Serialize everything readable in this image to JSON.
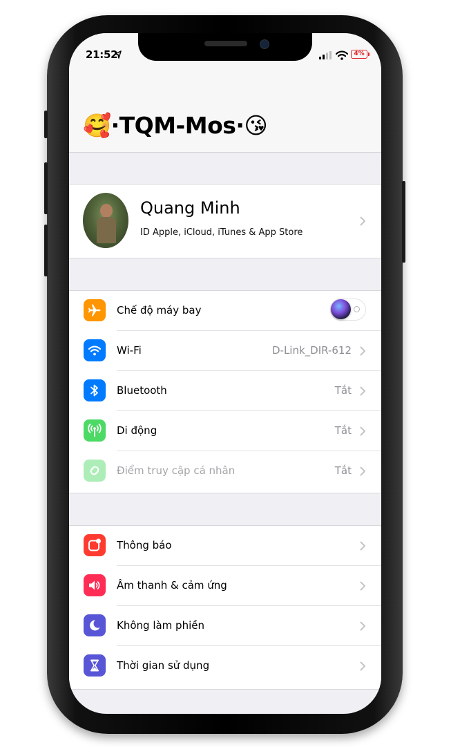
{
  "status": {
    "time": "21:52",
    "battery": "4%",
    "colors": {
      "battery": "#e0242a"
    }
  },
  "header": {
    "title": "🥰·TQM-Mos·😘"
  },
  "profile": {
    "name": "Quang Minh",
    "subtitle": "ID Apple, iCloud, iTunes & App Store"
  },
  "connectivity": [
    {
      "label": "Chế độ máy bay",
      "icon": "airplane-icon",
      "color": "#ff9500",
      "toggle": false
    },
    {
      "label": "Wi-Fi",
      "value": "D-Link_DIR-612",
      "icon": "wifi-icon",
      "color": "#007aff"
    },
    {
      "label": "Bluetooth",
      "value": "Tắt",
      "icon": "bluetooth-icon",
      "color": "#007aff"
    },
    {
      "label": "Di động",
      "value": "Tắt",
      "icon": "cellular-icon",
      "color": "#4cd964"
    },
    {
      "label": "Điểm truy cập cá nhân",
      "value": "Tắt",
      "icon": "hotspot-icon",
      "color": "#4cd964",
      "disabled": true
    }
  ],
  "system": [
    {
      "label": "Thông báo",
      "icon": "notifications-icon",
      "color": "#ff3b30"
    },
    {
      "label": "Âm thanh & cảm ứng",
      "icon": "sound-icon",
      "color": "#ff2d55"
    },
    {
      "label": "Không làm phiền",
      "icon": "moon-icon",
      "color": "#5856d6"
    },
    {
      "label": "Thời gian sử dụng",
      "icon": "hourglass-icon",
      "color": "#5856d6"
    }
  ]
}
